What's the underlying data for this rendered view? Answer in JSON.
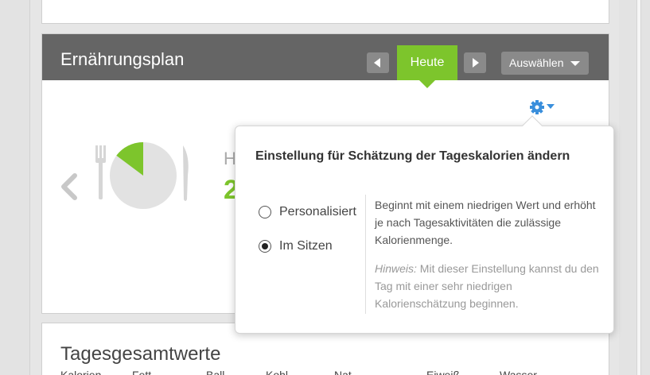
{
  "plan": {
    "title": "Ernährungsplan",
    "today_label": "Heute",
    "select_label": "Auswählen",
    "partial_heading": "H",
    "partial_value": "2"
  },
  "popover": {
    "title": "Einstellung für Schätzung der Tageskalorien ändern",
    "options": [
      {
        "label": "Personalisiert",
        "checked": false
      },
      {
        "label": "Im Sitzen",
        "checked": true
      }
    ],
    "description": "Beginnt mit einem niedrigen Wert und erhöht je nach Tagesaktivitäten die zulässige Kalorienmenge.",
    "hint_label": "Hinweis:",
    "hint_text": " Mit dieser Einstellung kannst du den Tag mit einer sehr niedrigen Kalorienschätzung beginnen."
  },
  "totals": {
    "title": "Tagesgesamtwerte",
    "columns": [
      "Kalorien",
      "Fett",
      "Ball",
      "Kohl",
      "Nat",
      "Eiweiß",
      "Wasser"
    ]
  },
  "colors": {
    "accent": "#7dc52c",
    "header_bg": "#656565",
    "gear_blue": "#3a8fdc"
  },
  "icons": [
    "chevron-left-icon",
    "chevron-right-icon",
    "caret-down-icon",
    "fork-icon",
    "knife-icon",
    "plate-chart-icon",
    "gear-icon"
  ]
}
